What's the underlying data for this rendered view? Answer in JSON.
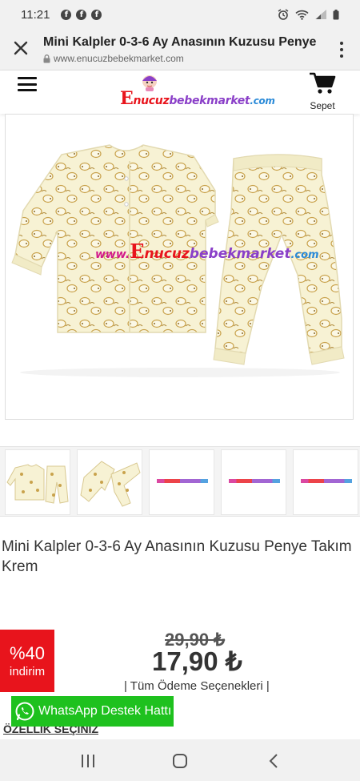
{
  "status": {
    "time": "11:21",
    "notif_icons": [
      "f",
      "f",
      "f"
    ]
  },
  "browser": {
    "title": "Mini Kalpler 0-3-6 Ay Anasının Kuzusu Penye",
    "url": "www.enucuzbebekmarket.com"
  },
  "header": {
    "logo_parts": [
      {
        "text": "E",
        "color": "#e8141c"
      },
      {
        "text": "nucuz",
        "color": "#e8141c"
      },
      {
        "text": "bebekmarket",
        "color": "#8a3fc8"
      },
      {
        "text": ".com",
        "color": "#2a8ad8"
      }
    ],
    "cart_label": "Sepet"
  },
  "watermark": {
    "parts": [
      {
        "text": "www.",
        "color": "#d21a8a"
      },
      {
        "text": "E",
        "color": "#e8141c"
      },
      {
        "text": "nucuz",
        "color": "#e8141c"
      },
      {
        "text": "bebekmarket",
        "color": "#8a3fc8"
      },
      {
        "text": ".com",
        "color": "#2a8ad8"
      }
    ]
  },
  "product": {
    "name": "Mini Kalpler 0-3-6 Ay Anasının Kuzusu Penye Takım Krem",
    "discount_pct": "%40",
    "discount_label": "indirim",
    "old_price": "29,90 ₺",
    "new_price": "17,90 ₺",
    "payment_options": "| Tüm Ödeme Seçenekleri |"
  },
  "whatsapp_label": "WhatsApp Destek Hattı",
  "feature_select_label": "ÖZELLİK SEÇİNİZ",
  "thumbnail_count": 5,
  "colors": {
    "discount": "#e8141c",
    "whatsapp": "#1ec11e",
    "garment": "#f7f2d4",
    "print": "#c9a24c"
  }
}
